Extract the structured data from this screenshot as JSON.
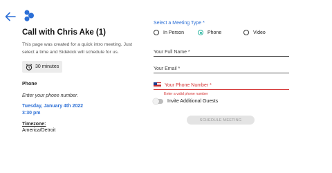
{
  "header": {
    "back_icon": "arrow-left-icon",
    "logo_icon": "sidekick-logo-icon",
    "brand_color": "#2c6fd6"
  },
  "meeting": {
    "title": "Call with Chris Ake (1)",
    "description": "This page was created for a quick intro meeting. Just select a time and Sidekick will schedule for us.",
    "duration": "30 minutes",
    "phone_label": "Phone",
    "phone_prompt": "Enter your phone number.",
    "date": "Tuesday, January 4th 2022",
    "time": "3:30 pm",
    "timezone_label": "Timezone:",
    "timezone_value": "America/Detroit"
  },
  "form": {
    "meeting_type_label": "Select a Meeting Type *",
    "meeting_types": [
      {
        "label": "In Person",
        "selected": false
      },
      {
        "label": "Phone",
        "selected": true
      },
      {
        "label": "Video",
        "selected": false
      }
    ],
    "full_name_label": "Your Full Name *",
    "email_label": "Your Email *",
    "phone_label": "Your Phone Number *",
    "phone_error": "Enter a valid phone number",
    "guests_label": "Invite Additional Guests",
    "guests_enabled": false,
    "schedule_label": "SCHEDULE MEETING",
    "accent_color": "#2bb5a0",
    "error_color": "#d32f2f"
  }
}
